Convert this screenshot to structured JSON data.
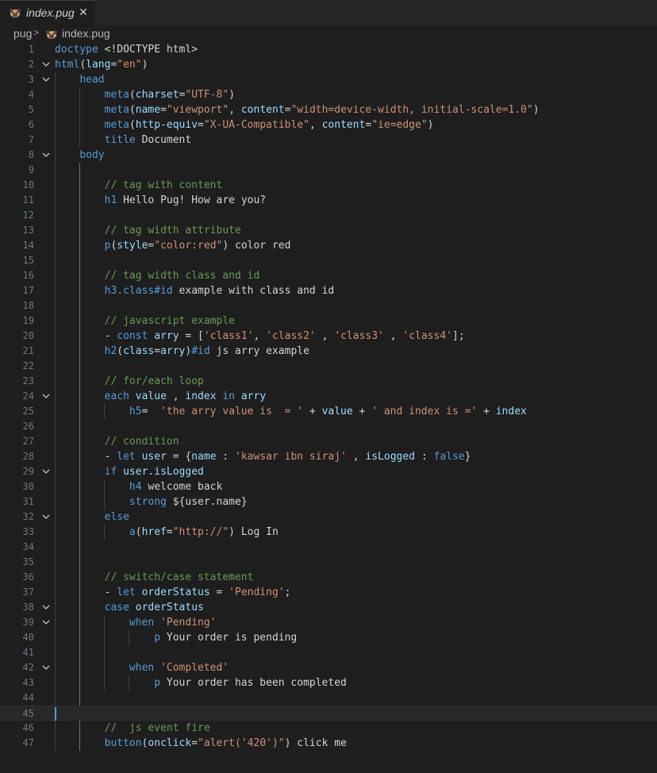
{
  "tab": {
    "label": "index.pug",
    "close": "✕"
  },
  "breadcrumb": {
    "folder": "pug",
    "separator": ">",
    "file": "index.pug"
  },
  "editor": {
    "cursor_line": 45,
    "lines": [
      {
        "n": "1",
        "fold": "",
        "tokens": [
          [
            "k",
            "doctype"
          ],
          [
            "w",
            " <!DOCTYPE html>"
          ]
        ]
      },
      {
        "n": "2",
        "fold": "v",
        "tokens": [
          [
            "k",
            "html"
          ],
          [
            "w",
            "("
          ],
          [
            "a",
            "lang"
          ],
          [
            "w",
            "="
          ],
          [
            "s",
            "\"en\""
          ],
          [
            "w",
            ")"
          ]
        ]
      },
      {
        "n": "3",
        "fold": "v",
        "tokens": [
          [
            "w",
            "    "
          ],
          [
            "k",
            "head"
          ]
        ]
      },
      {
        "n": "4",
        "fold": "",
        "tokens": [
          [
            "w",
            "        "
          ],
          [
            "k",
            "meta"
          ],
          [
            "w",
            "("
          ],
          [
            "a",
            "charset"
          ],
          [
            "w",
            "="
          ],
          [
            "s",
            "\"UTF-8\""
          ],
          [
            "w",
            ")"
          ]
        ]
      },
      {
        "n": "5",
        "fold": "",
        "tokens": [
          [
            "w",
            "        "
          ],
          [
            "k",
            "meta"
          ],
          [
            "w",
            "("
          ],
          [
            "a",
            "name"
          ],
          [
            "w",
            "="
          ],
          [
            "s",
            "\"viewport\""
          ],
          [
            "w",
            ", "
          ],
          [
            "a",
            "content"
          ],
          [
            "w",
            "="
          ],
          [
            "s",
            "\"width=device-width, initial-scale=1.0\""
          ],
          [
            "w",
            ")"
          ]
        ]
      },
      {
        "n": "6",
        "fold": "",
        "tokens": [
          [
            "w",
            "        "
          ],
          [
            "k",
            "meta"
          ],
          [
            "w",
            "("
          ],
          [
            "a",
            "http-equiv"
          ],
          [
            "w",
            "="
          ],
          [
            "s",
            "\"X-UA-Compatible\""
          ],
          [
            "w",
            ", "
          ],
          [
            "a",
            "content"
          ],
          [
            "w",
            "="
          ],
          [
            "s",
            "\"ie=edge\""
          ],
          [
            "w",
            ")"
          ]
        ]
      },
      {
        "n": "7",
        "fold": "",
        "tokens": [
          [
            "w",
            "        "
          ],
          [
            "k",
            "title"
          ],
          [
            "w",
            " Document"
          ]
        ]
      },
      {
        "n": "8",
        "fold": "v",
        "tokens": [
          [
            "w",
            "    "
          ],
          [
            "k",
            "body"
          ]
        ]
      },
      {
        "n": "9",
        "fold": "",
        "tokens": []
      },
      {
        "n": "10",
        "fold": "",
        "tokens": [
          [
            "w",
            "        "
          ],
          [
            "c",
            "// tag with content"
          ]
        ]
      },
      {
        "n": "11",
        "fold": "",
        "tokens": [
          [
            "w",
            "        "
          ],
          [
            "k",
            "h1"
          ],
          [
            "w",
            " Hello Pug! How are you?"
          ]
        ]
      },
      {
        "n": "12",
        "fold": "",
        "tokens": []
      },
      {
        "n": "13",
        "fold": "",
        "tokens": [
          [
            "w",
            "        "
          ],
          [
            "c",
            "// tag width attribute"
          ]
        ]
      },
      {
        "n": "14",
        "fold": "",
        "tokens": [
          [
            "w",
            "        "
          ],
          [
            "k",
            "p"
          ],
          [
            "w",
            "("
          ],
          [
            "a",
            "style"
          ],
          [
            "w",
            "="
          ],
          [
            "s",
            "\"color:red\""
          ],
          [
            "w",
            ") color red"
          ]
        ]
      },
      {
        "n": "15",
        "fold": "",
        "tokens": []
      },
      {
        "n": "16",
        "fold": "",
        "tokens": [
          [
            "w",
            "        "
          ],
          [
            "c",
            "// tag width class and id"
          ]
        ]
      },
      {
        "n": "17",
        "fold": "",
        "tokens": [
          [
            "w",
            "        "
          ],
          [
            "k",
            "h3.class#id"
          ],
          [
            "w",
            " example with class and id"
          ]
        ]
      },
      {
        "n": "18",
        "fold": "",
        "tokens": []
      },
      {
        "n": "19",
        "fold": "",
        "tokens": [
          [
            "w",
            "        "
          ],
          [
            "c",
            "// javascript example"
          ]
        ]
      },
      {
        "n": "20",
        "fold": "",
        "tokens": [
          [
            "w",
            "        "
          ],
          [
            "w",
            "- "
          ],
          [
            "k",
            "const"
          ],
          [
            "w",
            " "
          ],
          [
            "v",
            "arry"
          ],
          [
            "w",
            " = ["
          ],
          [
            "s",
            "'class1'"
          ],
          [
            "w",
            ", "
          ],
          [
            "s",
            "'class2'"
          ],
          [
            "w",
            " , "
          ],
          [
            "s",
            "'class3'"
          ],
          [
            "w",
            " , "
          ],
          [
            "s",
            "'class4'"
          ],
          [
            "w",
            "];"
          ]
        ]
      },
      {
        "n": "21",
        "fold": "",
        "tokens": [
          [
            "w",
            "        "
          ],
          [
            "k",
            "h2"
          ],
          [
            "w",
            "("
          ],
          [
            "a",
            "class"
          ],
          [
            "w",
            "="
          ],
          [
            "v",
            "arry"
          ],
          [
            "w",
            ")"
          ],
          [
            "k",
            "#id"
          ],
          [
            "w",
            " js arry example"
          ]
        ]
      },
      {
        "n": "22",
        "fold": "",
        "tokens": []
      },
      {
        "n": "23",
        "fold": "",
        "tokens": [
          [
            "w",
            "        "
          ],
          [
            "c",
            "// for/each loop"
          ]
        ]
      },
      {
        "n": "24",
        "fold": "v",
        "tokens": [
          [
            "w",
            "        "
          ],
          [
            "k",
            "each"
          ],
          [
            "w",
            " "
          ],
          [
            "v",
            "value"
          ],
          [
            "w",
            " , "
          ],
          [
            "v",
            "index"
          ],
          [
            "w",
            " "
          ],
          [
            "k",
            "in"
          ],
          [
            "w",
            " "
          ],
          [
            "v",
            "arry"
          ]
        ]
      },
      {
        "n": "25",
        "fold": "",
        "tokens": [
          [
            "w",
            "            "
          ],
          [
            "k",
            "h5"
          ],
          [
            "w",
            "=  "
          ],
          [
            "s",
            "'the arry value is  = '"
          ],
          [
            "w",
            " + "
          ],
          [
            "v",
            "value"
          ],
          [
            "w",
            " + "
          ],
          [
            "s",
            "' and index is ='"
          ],
          [
            "w",
            " + "
          ],
          [
            "v",
            "index"
          ]
        ]
      },
      {
        "n": "26",
        "fold": "",
        "tokens": []
      },
      {
        "n": "27",
        "fold": "",
        "tokens": [
          [
            "w",
            "        "
          ],
          [
            "c",
            "// condition"
          ]
        ]
      },
      {
        "n": "28",
        "fold": "",
        "tokens": [
          [
            "w",
            "        "
          ],
          [
            "w",
            "- "
          ],
          [
            "k",
            "let"
          ],
          [
            "w",
            " "
          ],
          [
            "v",
            "user"
          ],
          [
            "w",
            " = {"
          ],
          [
            "v",
            "name"
          ],
          [
            "w",
            " : "
          ],
          [
            "s",
            "'kawsar ibn siraj'"
          ],
          [
            "w",
            " , "
          ],
          [
            "v",
            "isLogged"
          ],
          [
            "w",
            " : "
          ],
          [
            "k",
            "false"
          ],
          [
            "w",
            "}"
          ]
        ]
      },
      {
        "n": "29",
        "fold": "v",
        "tokens": [
          [
            "w",
            "        "
          ],
          [
            "k",
            "if"
          ],
          [
            "w",
            " "
          ],
          [
            "v",
            "user"
          ],
          [
            "w",
            "."
          ],
          [
            "v",
            "isLogged"
          ]
        ]
      },
      {
        "n": "30",
        "fold": "",
        "tokens": [
          [
            "w",
            "            "
          ],
          [
            "k",
            "h4"
          ],
          [
            "w",
            " welcome back"
          ]
        ]
      },
      {
        "n": "31",
        "fold": "",
        "tokens": [
          [
            "w",
            "            "
          ],
          [
            "k",
            "strong"
          ],
          [
            "w",
            " ${user.name}"
          ]
        ]
      },
      {
        "n": "32",
        "fold": "v",
        "tokens": [
          [
            "w",
            "        "
          ],
          [
            "k",
            "else"
          ]
        ]
      },
      {
        "n": "33",
        "fold": "",
        "tokens": [
          [
            "w",
            "            "
          ],
          [
            "k",
            "a"
          ],
          [
            "w",
            "("
          ],
          [
            "a",
            "href"
          ],
          [
            "w",
            "="
          ],
          [
            "s",
            "\"http://\""
          ],
          [
            "w",
            ") Log In"
          ]
        ]
      },
      {
        "n": "34",
        "fold": "",
        "tokens": []
      },
      {
        "n": "35",
        "fold": "",
        "tokens": []
      },
      {
        "n": "36",
        "fold": "",
        "tokens": [
          [
            "w",
            "        "
          ],
          [
            "c",
            "// switch/case statement"
          ]
        ]
      },
      {
        "n": "37",
        "fold": "",
        "tokens": [
          [
            "w",
            "        "
          ],
          [
            "w",
            "- "
          ],
          [
            "k",
            "let"
          ],
          [
            "w",
            " "
          ],
          [
            "v",
            "orderStatus"
          ],
          [
            "w",
            " = "
          ],
          [
            "s",
            "'Pending'"
          ],
          [
            "w",
            ";"
          ]
        ]
      },
      {
        "n": "38",
        "fold": "v",
        "tokens": [
          [
            "w",
            "        "
          ],
          [
            "k",
            "case"
          ],
          [
            "w",
            " "
          ],
          [
            "v",
            "orderStatus"
          ]
        ]
      },
      {
        "n": "39",
        "fold": "v",
        "tokens": [
          [
            "w",
            "            "
          ],
          [
            "k",
            "when"
          ],
          [
            "w",
            " "
          ],
          [
            "s",
            "'Pending'"
          ]
        ]
      },
      {
        "n": "40",
        "fold": "",
        "tokens": [
          [
            "w",
            "                "
          ],
          [
            "k",
            "p"
          ],
          [
            "w",
            " Your order is pending"
          ]
        ]
      },
      {
        "n": "41",
        "fold": "",
        "tokens": []
      },
      {
        "n": "42",
        "fold": "v",
        "tokens": [
          [
            "w",
            "            "
          ],
          [
            "k",
            "when"
          ],
          [
            "w",
            " "
          ],
          [
            "s",
            "'Completed'"
          ]
        ]
      },
      {
        "n": "43",
        "fold": "",
        "tokens": [
          [
            "w",
            "                "
          ],
          [
            "k",
            "p"
          ],
          [
            "w",
            " Your order has been completed"
          ]
        ]
      },
      {
        "n": "44",
        "fold": "",
        "tokens": []
      },
      {
        "n": "45",
        "fold": "",
        "tokens": []
      },
      {
        "n": "46",
        "fold": "",
        "tokens": [
          [
            "w",
            "        "
          ],
          [
            "c",
            "//  js event fire"
          ]
        ]
      },
      {
        "n": "47",
        "fold": "",
        "tokens": [
          [
            "w",
            "        "
          ],
          [
            "k",
            "button"
          ],
          [
            "w",
            "("
          ],
          [
            "a",
            "onclick"
          ],
          [
            "w",
            "="
          ],
          [
            "s",
            "\"alert('420')\""
          ],
          [
            "w",
            ") click me"
          ]
        ]
      }
    ]
  },
  "colors": {
    "background": "#1e1e1e",
    "keyword": "#569cd6",
    "attribute": "#9cdcfe",
    "string": "#ce9178",
    "comment": "#6a9955",
    "text": "#d4d4d4"
  },
  "icons": {
    "file_icon": "pug-icon",
    "fold_icon": "chevron-down-icon",
    "close_icon": "close-icon"
  }
}
